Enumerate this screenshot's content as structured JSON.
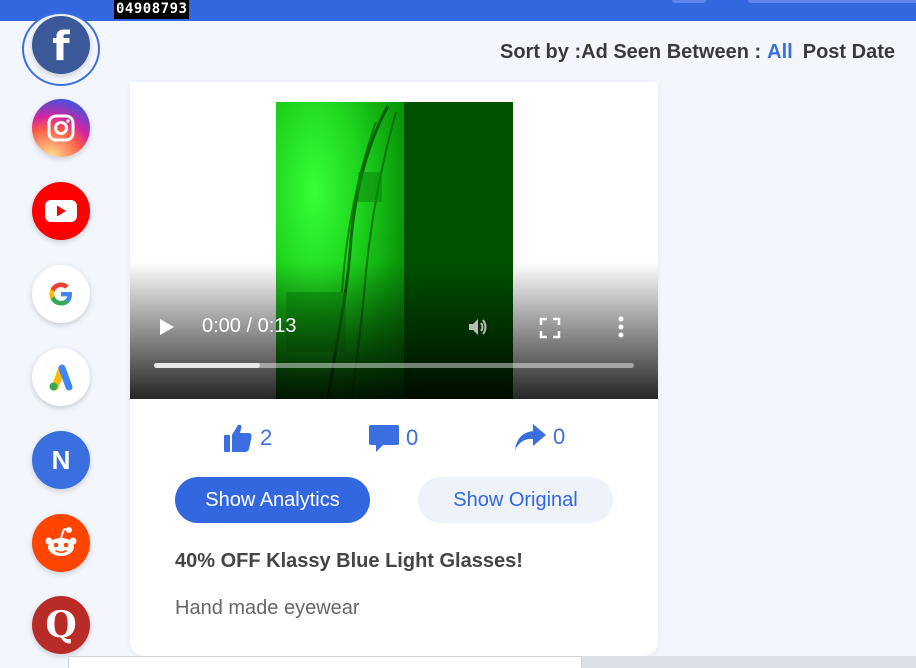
{
  "topbar": {
    "id_tag": "04908793"
  },
  "sidebar": {
    "items": [
      {
        "name": "facebook",
        "letter": "f",
        "active": true
      },
      {
        "name": "instagram"
      },
      {
        "name": "youtube"
      },
      {
        "name": "google",
        "letter": "G"
      },
      {
        "name": "google-ads"
      },
      {
        "name": "native",
        "letter": "N"
      },
      {
        "name": "reddit"
      },
      {
        "name": "quora",
        "letter": "Q"
      }
    ]
  },
  "sort": {
    "sort_label": "Sort by :",
    "ad_seen_label": "Ad Seen Between :",
    "ad_seen_value": "All",
    "post_date_label": "Post Date"
  },
  "video": {
    "time": "0:00 / 0:13",
    "progress_fraction": 0.22
  },
  "stats": {
    "likes": "2",
    "comments": "0",
    "shares": "0"
  },
  "actions": {
    "show_analytics": "Show Analytics",
    "show_original": "Show Original"
  },
  "ad": {
    "title": "40% OFF Klassy Blue Light Glasses!",
    "description": "Hand made eyewear"
  },
  "colors": {
    "accent": "#3367e0",
    "facebook": "#3b5998",
    "youtube": "#ff0000",
    "native": "#3b6fe0",
    "reddit": "#ff4500",
    "quora": "#b92b27"
  }
}
